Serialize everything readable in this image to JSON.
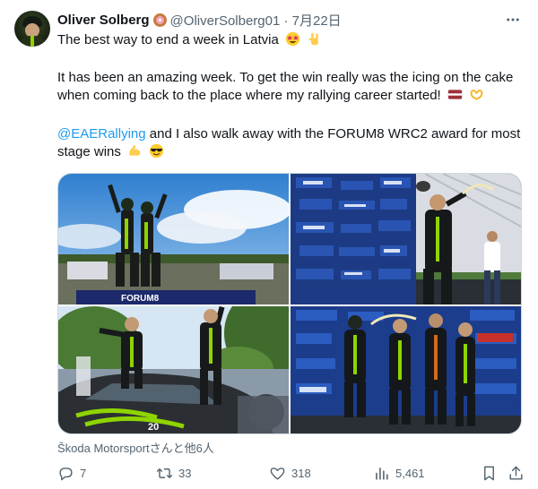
{
  "author": {
    "name": "Oliver Solberg",
    "handle_date": "@OliverSolberg01 · 7月22日"
  },
  "tweet": {
    "line1": "The best way to end a week in Latvia",
    "line2": "It has been an amazing week. To get the win really was the icing on the cake",
    "line3": "when coming back to the place where my rallying career started!",
    "mention": "@EAERallying",
    "line4_rest": " and I also walk away with the FORUM8 WRC2 award for most",
    "line5": "stage wins"
  },
  "media": {
    "banner_text": "FORUM8",
    "car_number": "20"
  },
  "tagged": {
    "text": "Škoda Motorsportさんと他6人"
  },
  "actions": {
    "replies": "7",
    "retweets": "33",
    "likes": "318",
    "views": "5,461"
  },
  "icons": {
    "more": "more-horizontal-icon",
    "reply": "reply-icon",
    "retweet": "retweet-icon",
    "like": "heart-icon",
    "views": "analytics-icon",
    "bookmark": "bookmark-icon",
    "share": "share-icon",
    "tag": "person-tag-icon"
  },
  "colors": {
    "accent": "#1d9bf0",
    "text": "#0f1419",
    "muted": "#536471",
    "border": "#cfd9de"
  }
}
